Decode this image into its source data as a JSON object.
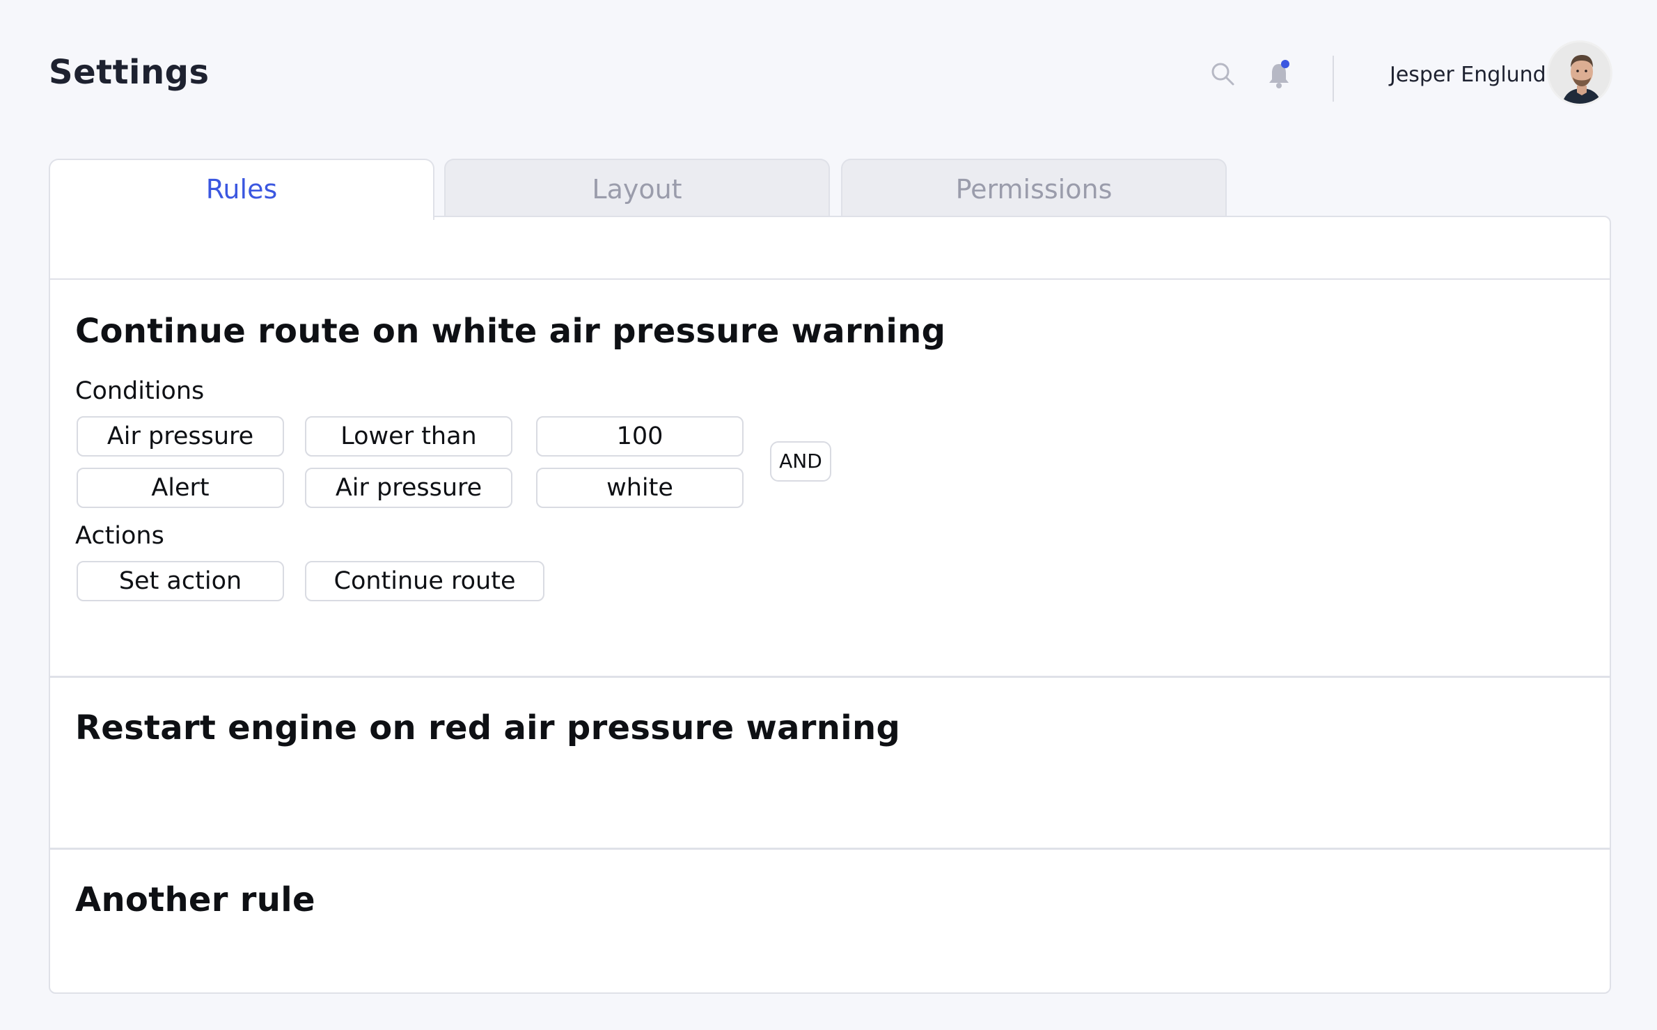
{
  "header": {
    "title": "Settings",
    "user_name": "Jesper Englund"
  },
  "tabs": [
    {
      "label": "Rules",
      "active": true
    },
    {
      "label": "Layout",
      "active": false
    },
    {
      "label": "Permissions",
      "active": false
    }
  ],
  "rules": [
    {
      "title": "Continue route on white air pressure warning",
      "conditions_label": "Conditions",
      "conditions": [
        [
          "Air pressure",
          "Lower than",
          "100"
        ],
        [
          "Alert",
          "Air pressure",
          "white"
        ]
      ],
      "operator": "AND",
      "actions_label": "Actions",
      "actions": [
        "Set action",
        "Continue route"
      ]
    },
    {
      "title": "Restart engine on red air pressure warning"
    },
    {
      "title": "Another rule"
    }
  ],
  "colors": {
    "accent": "#3b57e0",
    "notification_dot": "#3b57e0",
    "background": "#f6f7fb",
    "border": "#dfe1e8"
  },
  "icons": {
    "search": "search-icon",
    "notifications": "bell-icon"
  }
}
